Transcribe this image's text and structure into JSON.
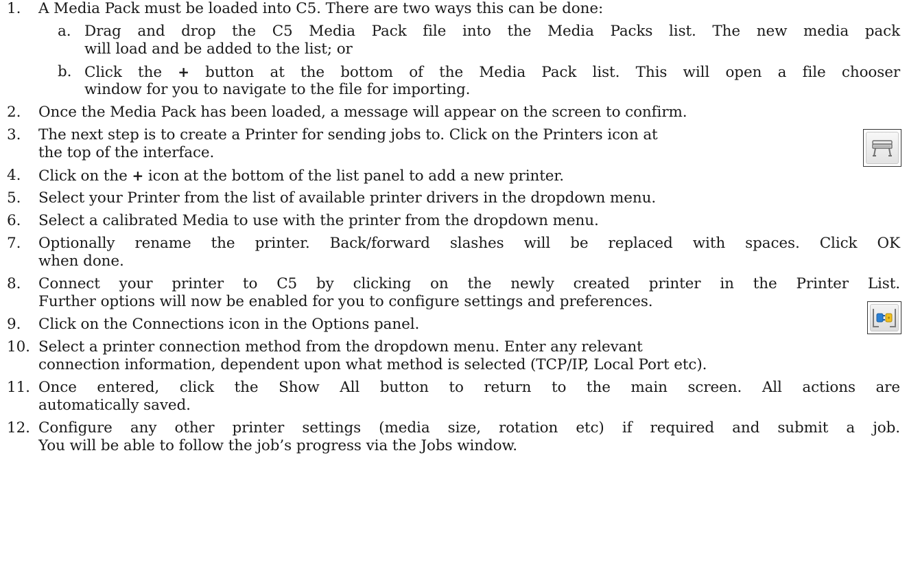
{
  "steps": [
    {
      "num": "1.",
      "lines": [
        "A Media Pack must be loaded into C5. There are two ways this can be done:"
      ]
    },
    {
      "num": "2.",
      "lines": [
        "Once the Media Pack has been loaded, a message will appear on the screen to confirm."
      ]
    },
    {
      "num": "3.",
      "lines": [
        "The next step is to create a Printer for sending jobs to. Click on the Printers icon at",
        "the top of the interface."
      ]
    },
    {
      "num": "4.",
      "before": "Click on the ",
      "plus": "+",
      "after": " icon at the bottom of the list panel to add a new printer."
    },
    {
      "num": "5.",
      "lines": [
        "Select your Printer from the list of available printer drivers in the dropdown menu."
      ]
    },
    {
      "num": "6.",
      "lines": [
        "Select a calibrated Media to use with the printer from the dropdown menu."
      ]
    },
    {
      "num": "7.",
      "lines": [
        "Optionally rename the printer. Back/forward slashes will be replaced with spaces. Click OK",
        "when done."
      ]
    },
    {
      "num": "8.",
      "lines": [
        "Connect your printer to C5 by clicking on the newly created printer in the Printer List.",
        "Further options will now be enabled for you to configure settings and preferences."
      ]
    },
    {
      "num": "9.",
      "lines": [
        "Click on the Connections icon in the Options panel."
      ]
    },
    {
      "num": "10.",
      "lines": [
        "Select a printer connection method from the dropdown menu. Enter any relevant",
        "connection information, dependent upon what method is selected (TCP/IP, Local Port etc)."
      ]
    },
    {
      "num": "11.",
      "lines": [
        "Once entered, click the Show All button to return to the main screen. All actions are",
        "automatically saved."
      ]
    },
    {
      "num": "12.",
      "lines": [
        "Configure any other printer settings (media size, rotation etc) if required and submit a job.",
        "You will be able to follow the job’s progress via the Jobs window."
      ]
    }
  ],
  "substeps": [
    {
      "letter": "a.",
      "lines": [
        "Drag and drop the C5 Media Pack file into the Media Packs list. The new media pack",
        "will load and be added to the list; or"
      ]
    },
    {
      "letter": "b.",
      "before": "Click the ",
      "plus": "+",
      "after": " button at the bottom of the Media Pack list. This will open a file chooser",
      "line2": "window for you to navigate to the file for importing."
    }
  ],
  "icons": {
    "printers": "printer-icon",
    "connections": "connections-plug-icon"
  },
  "colors": {
    "text": "#1a1a1a",
    "plug_blue": "#2a7fd4",
    "plug_yellow": "#f0c020"
  }
}
